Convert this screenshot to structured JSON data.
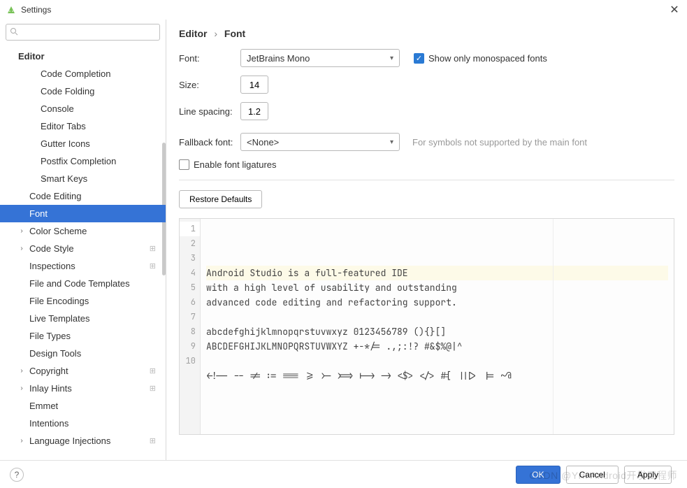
{
  "window": {
    "title": "Settings",
    "close_glyph": "✕"
  },
  "search": {
    "placeholder": ""
  },
  "tree": [
    {
      "label": "Editor",
      "level": 0,
      "bold": true,
      "arrow": ""
    },
    {
      "label": "Code Completion",
      "level": 2
    },
    {
      "label": "Code Folding",
      "level": 2
    },
    {
      "label": "Console",
      "level": 2
    },
    {
      "label": "Editor Tabs",
      "level": 2
    },
    {
      "label": "Gutter Icons",
      "level": 2
    },
    {
      "label": "Postfix Completion",
      "level": 2
    },
    {
      "label": "Smart Keys",
      "level": 2,
      "arrow": "›"
    },
    {
      "label": "Code Editing",
      "level": 1
    },
    {
      "label": "Font",
      "level": 1,
      "selected": true
    },
    {
      "label": "Color Scheme",
      "level": 1,
      "arrow": "›"
    },
    {
      "label": "Code Style",
      "level": 1,
      "arrow": "›",
      "gear": true
    },
    {
      "label": "Inspections",
      "level": 1,
      "gear": true
    },
    {
      "label": "File and Code Templates",
      "level": 1
    },
    {
      "label": "File Encodings",
      "level": 1
    },
    {
      "label": "Live Templates",
      "level": 1
    },
    {
      "label": "File Types",
      "level": 1
    },
    {
      "label": "Design Tools",
      "level": 1
    },
    {
      "label": "Copyright",
      "level": 1,
      "arrow": "›",
      "gear": true
    },
    {
      "label": "Inlay Hints",
      "level": 1,
      "arrow": "›",
      "gear": true
    },
    {
      "label": "Emmet",
      "level": 1
    },
    {
      "label": "Intentions",
      "level": 1
    },
    {
      "label": "Language Injections",
      "level": 1,
      "arrow": "›",
      "gear": true
    }
  ],
  "breadcrumb": {
    "root": "Editor",
    "leaf": "Font"
  },
  "form": {
    "font_label": "Font:",
    "font_value": "JetBrains Mono",
    "mono_checkbox": "Show only monospaced fonts",
    "size_label": "Size:",
    "size_value": "14",
    "linespacing_label": "Line spacing:",
    "linespacing_value": "1.2",
    "fallback_label": "Fallback font:",
    "fallback_value": "<None>",
    "fallback_hint": "For symbols not supported by the main font",
    "ligatures_label": "Enable font ligatures",
    "restore_defaults": "Restore Defaults"
  },
  "preview": {
    "line_numbers": [
      "1",
      "2",
      "3",
      "4",
      "5",
      "6",
      "7",
      "8",
      "9",
      "10"
    ],
    "lines": [
      "Android Studio is a full-featured IDE",
      "with a high level of usability and outstanding",
      "advanced code editing and refactoring support.",
      "",
      "abcdefghijklmnopqrstuvwxyz 0123456789 (){}[]",
      "ABCDEFGHIJKLMNOPQRSTUVWXYZ +-*/= .,;:!? #&$%@|^",
      "",
      "<!-- -- != := === >= >- >=> |-> -> <$> </> #[ |||> |= ~@",
      "",
      ""
    ]
  },
  "footer": {
    "ok": "OK",
    "cancel": "Cancel",
    "apply": "Apply"
  },
  "watermark": "CSDN @Yrn Android开发工程师"
}
